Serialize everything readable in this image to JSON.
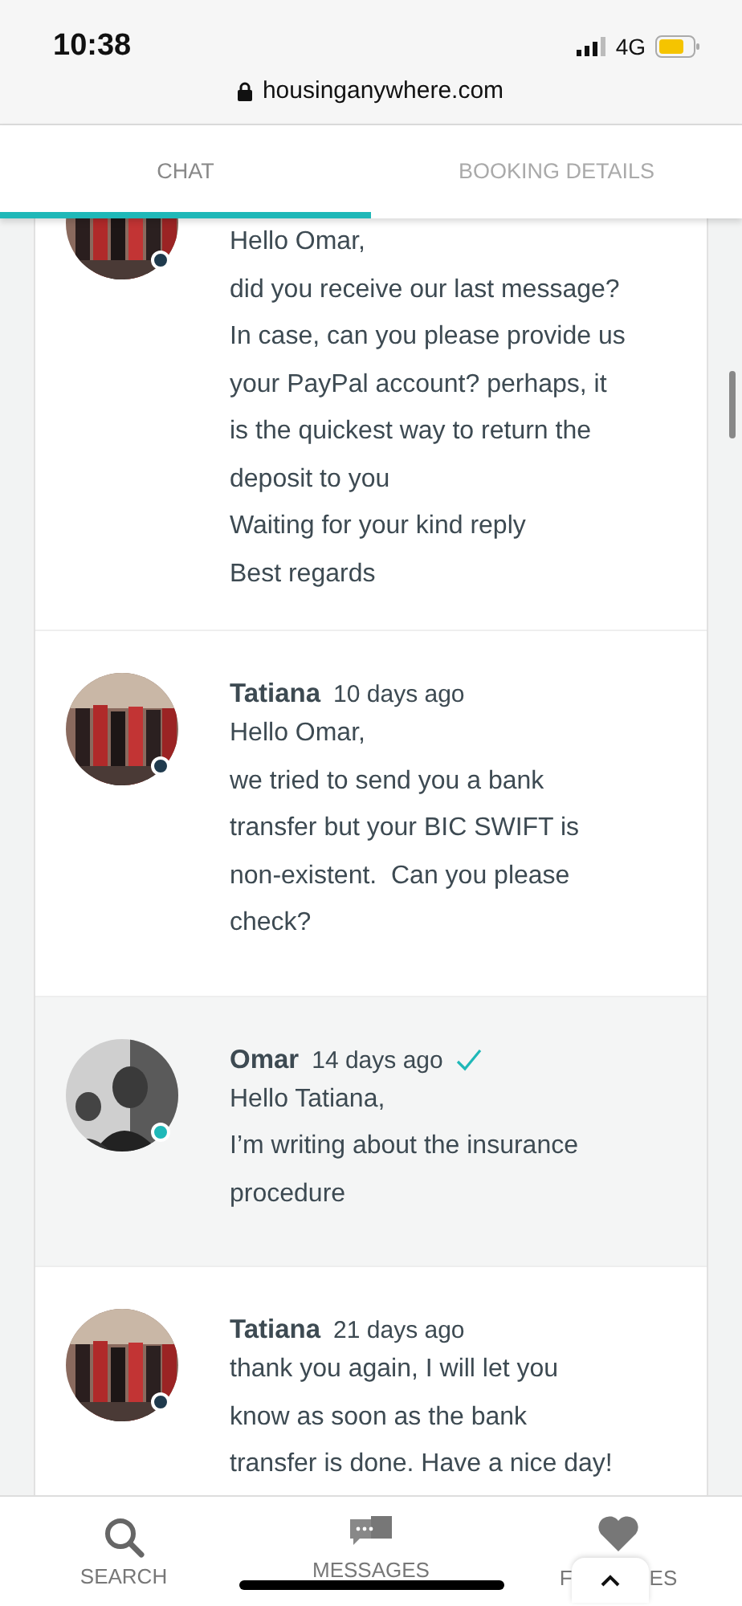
{
  "status_bar": {
    "time": "10:38",
    "network": "4G"
  },
  "address_bar": {
    "url": "housinganywhere.com"
  },
  "tabs": [
    {
      "label": "CHAT",
      "selected": true
    },
    {
      "label": "BOOKING DETAILS",
      "selected": false
    }
  ],
  "messages": [
    {
      "own": false,
      "read": false,
      "color": "#1f3a4d",
      "body": "Hello Omar,\ndid you receive our last message?\nIn case, can you please provide us\nyour PayPal account? perhaps, it\nis the quickest way to return the\ndeposit to you\nWaiting for your kind reply\nBest regards"
    },
    {
      "own": false,
      "read": false,
      "color": "#1f3a4d",
      "name": "Tatiana",
      "time": "10 days ago",
      "body": "Hello Omar,\nwe tried to send you a bank\ntransfer but your BIC SWIFT is\nnon-existent.  Can you please\ncheck?"
    },
    {
      "own": true,
      "read": true,
      "color": "#1fb8b8",
      "name": "Omar",
      "time": "14 days ago",
      "body": "Hello Tatiana,\nI’m writing about the insurance\nprocedure"
    },
    {
      "own": false,
      "read": false,
      "color": "#1f3a4d",
      "name": "Tatiana",
      "time": "21 days ago",
      "body": "thank you again, I will let you\nknow as soon as the bank\ntransfer is done. Have a nice day!"
    }
  ],
  "bottom_nav": [
    {
      "kind": "search",
      "label": "SEARCH"
    },
    {
      "kind": "messages",
      "label": "MESSAGES"
    },
    {
      "kind": "favorites",
      "label_start": "F",
      "label_end": "ES"
    }
  ]
}
